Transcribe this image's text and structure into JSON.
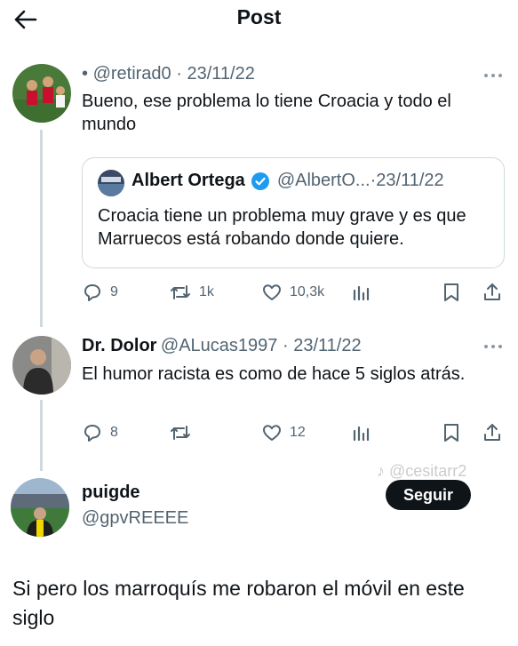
{
  "header": {
    "title": "Post"
  },
  "tweet1": {
    "handle": "@retirad0",
    "date": "23/11/22",
    "text": "Bueno, ese problema lo tiene Croacia y todo el mundo",
    "quote": {
      "name": "Albert Ortega",
      "handle": "@AlbertO...",
      "date": "23/11/22",
      "text": "Croacia tiene un problema muy grave y es que Marruecos está robando donde quiere."
    },
    "actions": {
      "replies": "9",
      "reposts": "1k",
      "likes": "10,3k"
    }
  },
  "tweet2": {
    "name": "Dr. Dolor",
    "handle": "@ALucas1997",
    "date": "23/11/22",
    "text": "El humor racista es como de hace 5 siglos atrás.",
    "actions": {
      "replies": "8",
      "reposts": "",
      "likes": "12"
    }
  },
  "main_post": {
    "name": "puigde",
    "handle": "@gpvREEEE",
    "follow_label": "Seguir",
    "text": "Si pero los marroquís me robaron el móvil en este siglo"
  },
  "watermark": {
    "text": "@cesitarr2"
  },
  "colors": {
    "text": "#0f1419",
    "muted": "#536471",
    "line": "#cfd9de",
    "verified": "#1d9bf0"
  },
  "icons": [
    "back-arrow-icon",
    "more-icon",
    "verified-badge-icon",
    "reply-icon",
    "repost-icon",
    "like-icon",
    "views-icon",
    "bookmark-icon",
    "share-icon",
    "tiktok-icon"
  ]
}
